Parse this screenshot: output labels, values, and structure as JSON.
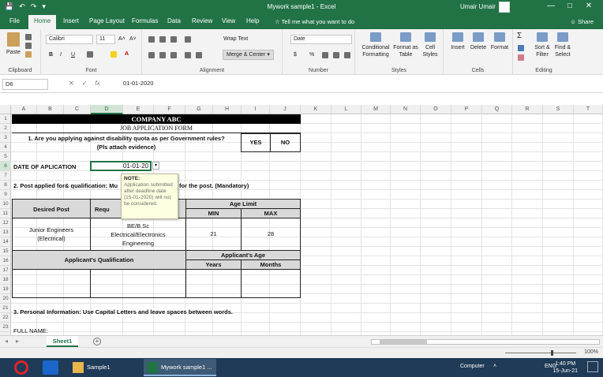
{
  "window": {
    "title": "Mywork sample1  -  Excel",
    "user": "Umair Umair",
    "controls": [
      "—",
      "□",
      "✕"
    ],
    "quick_access": [
      "💾",
      "↶",
      "↷",
      "▾"
    ]
  },
  "tabs": [
    "File",
    "Home",
    "Insert",
    "Page Layout",
    "Formulas",
    "Data",
    "Review",
    "View",
    "Help"
  ],
  "tell_me": "Tell me what you want to do",
  "share": "Share",
  "ribbon": {
    "clipboard": {
      "label": "Clipboard",
      "paste": "Paste"
    },
    "font": {
      "label": "Font",
      "name": "Calibri",
      "size": "11",
      "bold": "B",
      "italic": "I",
      "underline": "U"
    },
    "alignment": {
      "label": "Alignment",
      "wrap": "Wrap Text",
      "merge": "Merge & Center"
    },
    "number": {
      "label": "Number",
      "format": "Date",
      "currency": "$",
      "percent": "%"
    },
    "styles": {
      "label": "Styles",
      "cond": "Conditional Formatting",
      "table": "Format as Table",
      "cell": "Cell Styles"
    },
    "cells": {
      "label": "Cells",
      "insert": "Insert",
      "delete": "Delete",
      "format": "Format"
    },
    "editing": {
      "label": "Editing",
      "sort": "Sort & Filter",
      "find": "Find & Select"
    }
  },
  "formula_bar": {
    "name_box": "D6",
    "value": "01-01-2020",
    "symbols": [
      "✕",
      "✓",
      "fx"
    ]
  },
  "columns": [
    "A",
    "B",
    "C",
    "D",
    "E",
    "F",
    "G",
    "H",
    "I",
    "J",
    "K",
    "L",
    "M",
    "N",
    "O",
    "P",
    "Q",
    "R",
    "S",
    "T"
  ],
  "rows": [
    "1",
    "2",
    "3",
    "4",
    "5",
    "6",
    "7",
    "8",
    "9",
    "10",
    "11",
    "12",
    "13",
    "14",
    "15",
    "16",
    "17",
    "18",
    "19",
    "20",
    "21",
    "22",
    "23"
  ],
  "sheet": {
    "company": "COMPANY ABC",
    "form_title": "JOB APPLICATION FORM",
    "q1_line1": "1. Are you applying against disability quota as per Government rules?",
    "q1_line2": "(Pls attach evidence)",
    "yes": "YES",
    "no": "NO",
    "date_label": "DATE OF APLICATION",
    "date_value": "01-01-20",
    "q2_part1": "2. Post applied for& qualification: Mu",
    "q2_part2": "for the post. (Mandatory)",
    "age_limit": "Age Limit",
    "desired_post": "Desired Post",
    "required_q": "Requ",
    "min": "MIN",
    "max": "MAX",
    "post_line1": "Junior Engineers",
    "post_line2": "(Electrical)",
    "qual_line1": "BE/B.Sc",
    "qual_line2": "Electrical/Electronics",
    "qual_line3": "Engineering",
    "min_val": "21",
    "max_val": "28",
    "app_qual": "Applicant's Qualification",
    "app_age": "Applicant's Age",
    "years": "Years",
    "months": "Months",
    "q3": "3. Personal Information: Use Capital Letters and leave spaces between words.",
    "full_name": "FULL NAME:"
  },
  "comment": {
    "heading": "NOTE:",
    "body": "Application submitted after deadline date (15-01-2020) will not be considered."
  },
  "sheet_tab": "Sheet1",
  "add_sheet": "+",
  "zoom": "100%",
  "taskbar": {
    "apps": [
      "Sample1",
      "Mywork sample1 ..."
    ],
    "computer": "Computer",
    "lang": "ENG",
    "time": "1:40 PM",
    "date": "15-Jun-21"
  },
  "colors": {
    "excel_green": "#217346",
    "taskbar": "#1f3b57",
    "comment_bg": "#ffffe1"
  }
}
